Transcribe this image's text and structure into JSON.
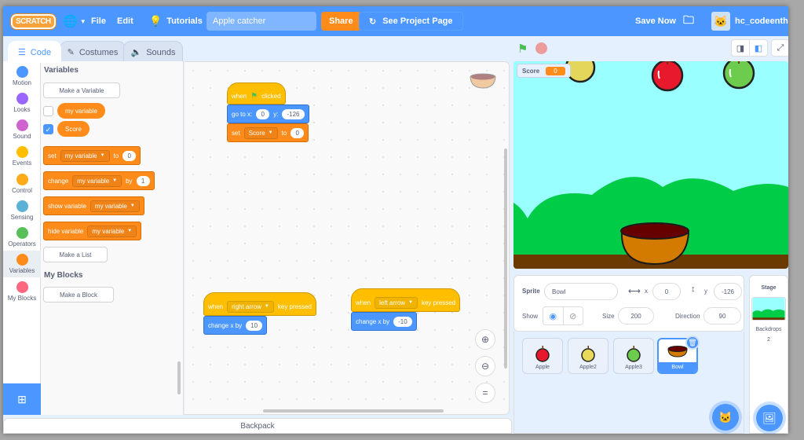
{
  "menubar": {
    "logo": "SCRATCH",
    "file": "File",
    "edit": "Edit",
    "tutorials": "Tutorials",
    "project_title": "Apple catcher",
    "share": "Share",
    "see_project_page": "See Project Page",
    "save_now": "Save Now",
    "username": "hc_codeenthu",
    "brand_color": "#4c97ff"
  },
  "tabs": [
    {
      "label": "Code",
      "active": true
    },
    {
      "label": "Costumes",
      "active": false
    },
    {
      "label": "Sounds",
      "active": false
    }
  ],
  "categories": [
    {
      "label": "Motion",
      "color": "#4c97ff"
    },
    {
      "label": "Looks",
      "color": "#9966ff"
    },
    {
      "label": "Sound",
      "color": "#cf63cf"
    },
    {
      "label": "Events",
      "color": "#ffbf00"
    },
    {
      "label": "Control",
      "color": "#ffab19"
    },
    {
      "label": "Sensing",
      "color": "#5cb1d6"
    },
    {
      "label": "Operators",
      "color": "#59c059"
    },
    {
      "label": "Variables",
      "color": "#ff8c1a",
      "selected": true
    },
    {
      "label": "My Blocks",
      "color": "#ff6680"
    }
  ],
  "palette": {
    "variables_heading": "Variables",
    "make_variable": "Make a Variable",
    "variables": [
      {
        "name": "my variable",
        "checked": false
      },
      {
        "name": "Score",
        "checked": true
      }
    ],
    "blocks": {
      "set": {
        "label": "set",
        "var": "my variable",
        "to": "to",
        "value": "0"
      },
      "change": {
        "label": "change",
        "var": "my variable",
        "by": "by",
        "value": "1"
      },
      "show": {
        "label": "show variable",
        "var": "my variable"
      },
      "hide": {
        "label": "hide variable",
        "var": "my variable"
      }
    },
    "make_list": "Make a List",
    "my_blocks_heading": "My Blocks",
    "make_block": "Make a Block"
  },
  "scripts": {
    "flag_script": {
      "when": "when",
      "clicked": "clicked",
      "goto": "go to x:",
      "x": "0",
      "y_label": "y:",
      "y": "-126",
      "set": "set",
      "var": "Score",
      "to": "to",
      "value": "0"
    },
    "right_script": {
      "when": "when",
      "key": "right arrow",
      "pressed": "key pressed",
      "change": "change x by",
      "value": "10"
    },
    "left_script": {
      "when": "when",
      "key": "left arrow",
      "pressed": "key pressed",
      "change": "change x by",
      "value": "-10"
    }
  },
  "backpack": "Backpack",
  "stage": {
    "monitor_label": "Score",
    "monitor_value": "0"
  },
  "sprite_info": {
    "sprite_label": "Sprite",
    "sprite_name": "Bowl",
    "x_label": "x",
    "x": "0",
    "y_label": "y",
    "y": "-126",
    "show_label": "Show",
    "size_label": "Size",
    "size": "200",
    "direction_label": "Direction",
    "direction": "90"
  },
  "sprites": [
    {
      "name": "Apple",
      "color": "#e8192c"
    },
    {
      "name": "Apple2",
      "color": "#e8d95a"
    },
    {
      "name": "Apple3",
      "color": "#6dcc4e"
    },
    {
      "name": "Bowl",
      "selected": true
    }
  ],
  "stage_panel": {
    "title": "Stage",
    "backdrops_label": "Backdrops",
    "backdrops_count": "2"
  }
}
